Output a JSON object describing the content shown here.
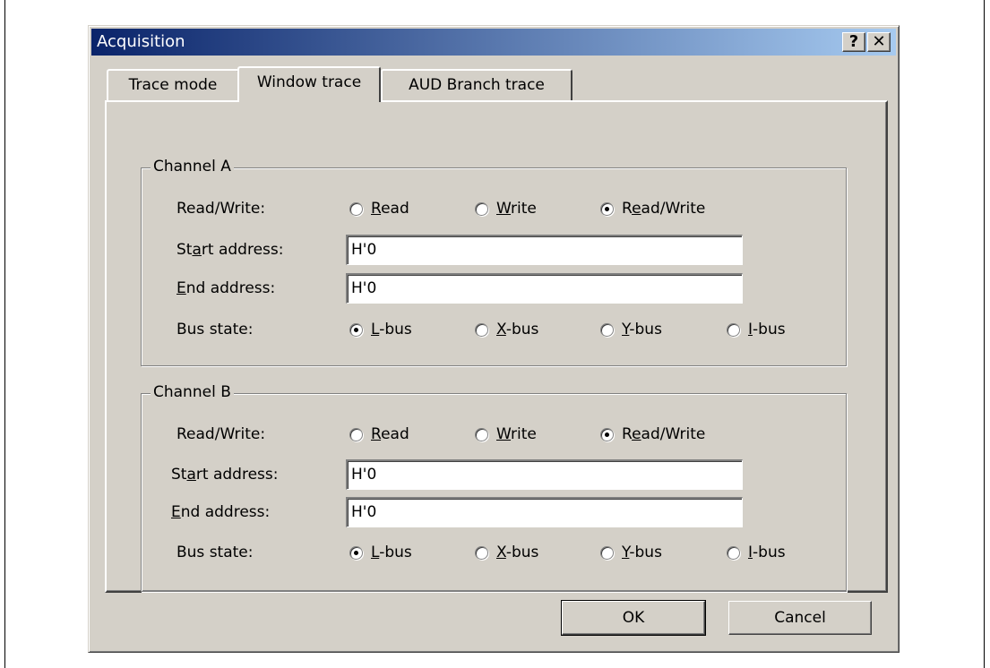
{
  "window": {
    "title": "Acquisition",
    "help_button": "?",
    "close_button": "✕"
  },
  "tabs": [
    {
      "label": "Trace mode",
      "active": false
    },
    {
      "label": "Window trace",
      "active": true
    },
    {
      "label": "AUD Branch trace",
      "active": false
    }
  ],
  "channel_a": {
    "legend": "Channel A",
    "rw_label": "Read/Write:",
    "rw_options": {
      "read": {
        "pre": "",
        "key": "R",
        "post": "ead"
      },
      "write": {
        "pre": "",
        "key": "W",
        "post": "rite"
      },
      "readwrite": {
        "pre": "R",
        "key": "e",
        "post": "ad/Write"
      }
    },
    "rw_selected": "Read/Write",
    "start": {
      "pre": "St",
      "key": "a",
      "post": "rt address:",
      "value": "H'0"
    },
    "end": {
      "pre": "",
      "key": "E",
      "post": "nd address:",
      "value": "H'0"
    },
    "bus_label": "Bus state:",
    "bus_options": {
      "l": {
        "key": "L",
        "post": "-bus"
      },
      "x": {
        "key": "X",
        "post": "-bus"
      },
      "y": {
        "key": "Y",
        "post": "-bus"
      },
      "i": {
        "key": "I",
        "post": "-bus"
      }
    },
    "bus_selected": "L-bus"
  },
  "channel_b": {
    "legend": "Channel B",
    "rw_label": "Read/Write:",
    "rw_options": {
      "read": {
        "pre": "",
        "key": "R",
        "post": "ead"
      },
      "write": {
        "pre": "",
        "key": "W",
        "post": "rite"
      },
      "readwrite": {
        "pre": "R",
        "key": "e",
        "post": "ad/Write"
      }
    },
    "rw_selected": "Read/Write",
    "start": {
      "pre": "St",
      "key": "a",
      "post": "rt address:",
      "value": "H'0"
    },
    "end": {
      "pre": "",
      "key": "E",
      "post": "nd address:",
      "value": "H'0"
    },
    "bus_label": "Bus state:",
    "bus_options": {
      "l": {
        "key": "L",
        "post": "-bus"
      },
      "x": {
        "key": "X",
        "post": "-bus"
      },
      "y": {
        "key": "Y",
        "post": "-bus"
      },
      "i": {
        "key": "I",
        "post": "-bus"
      }
    },
    "bus_selected": "L-bus"
  },
  "buttons": {
    "ok": "OK",
    "cancel": "Cancel"
  }
}
